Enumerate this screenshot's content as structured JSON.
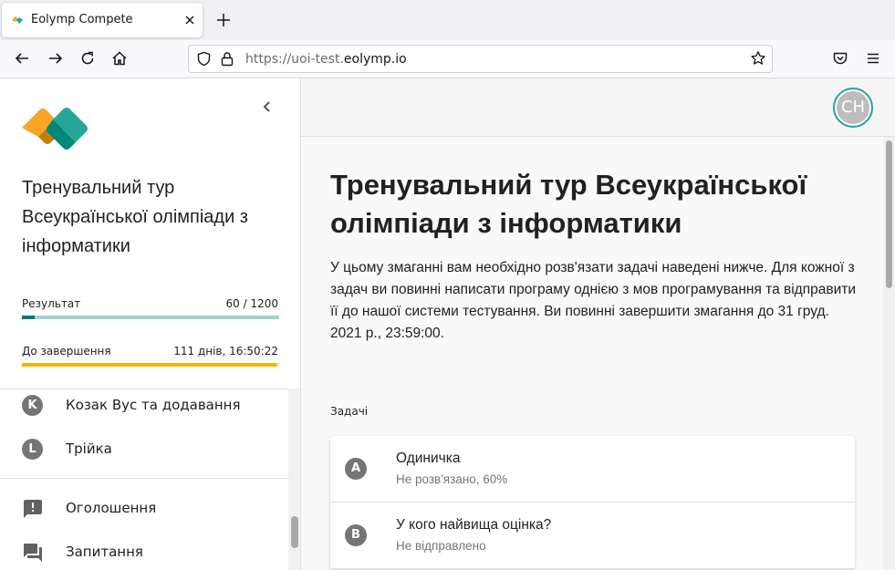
{
  "browser": {
    "tab_title": "Eolymp Compete",
    "url_prefix": "https://uoi-test.",
    "url_host": "eolymp.io"
  },
  "sidebar": {
    "contest_name": "Тренувальний тур Всеукраїнської олімпіади з інформатики",
    "result_label": "Результат",
    "result_value": "60 / 1200",
    "result_fraction": 0.05,
    "time_label": "До завершення",
    "time_value": "111 днів, 16:50:22",
    "time_fraction": 0.99,
    "problems": [
      {
        "letter": "K",
        "name": "Козак Вус та додавання"
      },
      {
        "letter": "L",
        "name": "Трійка"
      }
    ],
    "links": [
      {
        "icon": "announcement-icon",
        "label": "Оголошення"
      },
      {
        "icon": "questions-icon",
        "label": "Запитання"
      }
    ]
  },
  "header": {
    "avatar_initials": "CH"
  },
  "main": {
    "title": "Тренувальний тур Всеукраїнської олімпіади з інформатики",
    "description": "У цьому змаганні вам необхідно розв'язати задачі наведені нижче. Для кожної з задач ви повинні написати програму однією з мов програмування та відправити її до нашої системи тестування. Ви повинні завершити змагання до 31 груд. 2021 р., 23:59:00.",
    "section_label": "Задачі",
    "problems": [
      {
        "letter": "A",
        "name": "Одиничка",
        "status": "Не розв'язано, 60%"
      },
      {
        "letter": "B",
        "name": "У кого найвища оцінка?",
        "status": "Не відправлено"
      }
    ]
  },
  "colors": {
    "result_fill": "#00796b",
    "result_track": "#9fd3d0",
    "time_fill": "#f4b400",
    "avatar_ring": "#26a69a",
    "logo_orange": "#f5a623",
    "logo_teal": "#26a69a"
  }
}
